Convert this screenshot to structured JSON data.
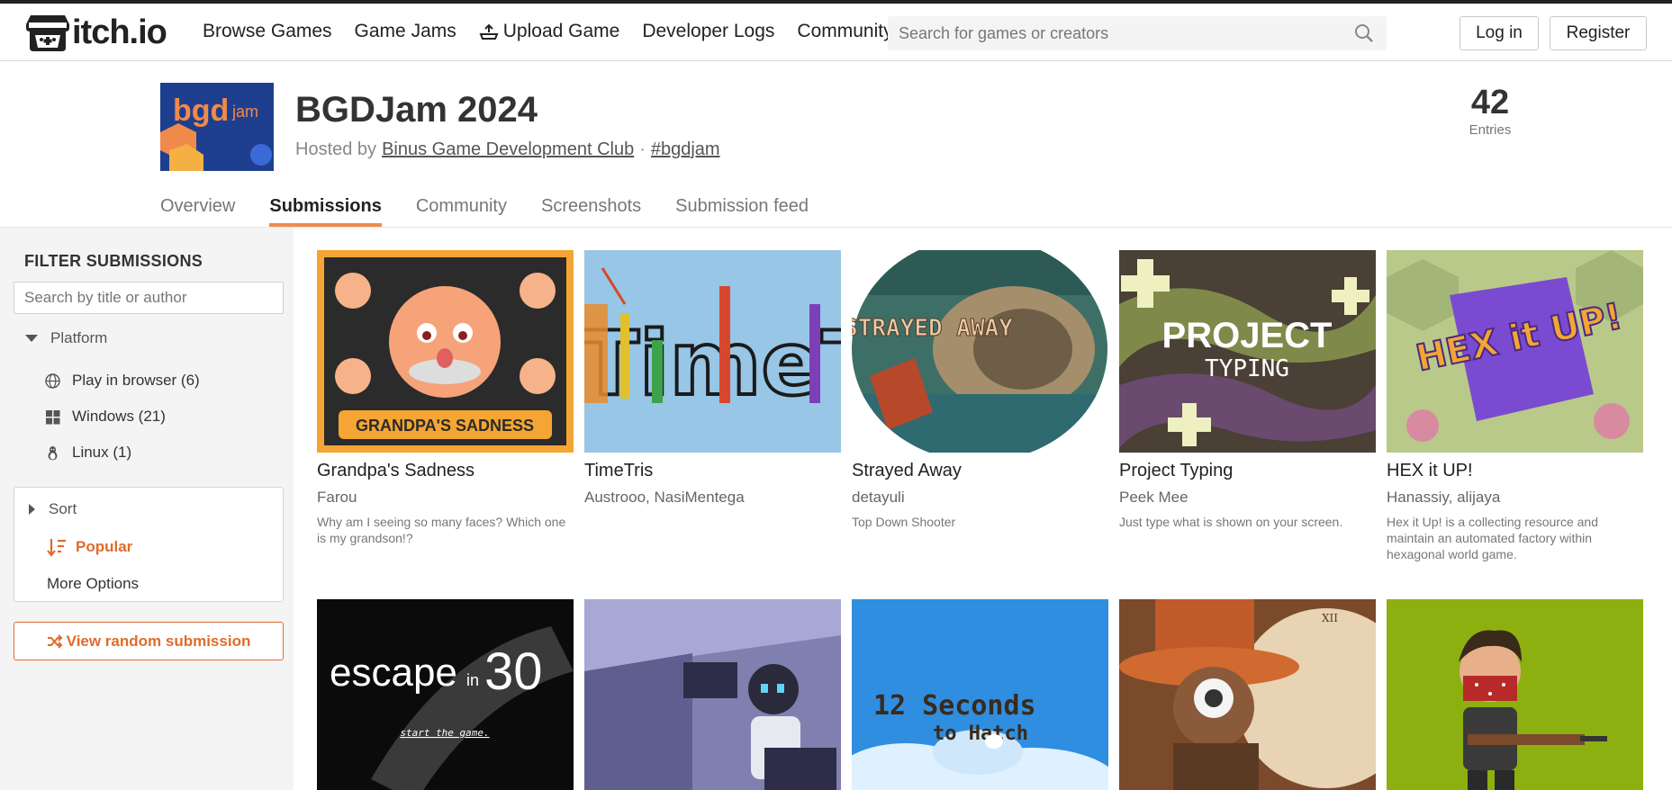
{
  "header": {
    "logo_text": "itch.io",
    "nav": [
      {
        "label": "Browse Games"
      },
      {
        "label": "Game Jams"
      },
      {
        "label": "Upload Game"
      },
      {
        "label": "Developer Logs"
      },
      {
        "label": "Community"
      }
    ],
    "search_placeholder": "Search for games or creators",
    "login_label": "Log in",
    "register_label": "Register"
  },
  "jam": {
    "title": "BGDJam 2024",
    "hosted_prefix": "Hosted by",
    "host": "Binus Game Development Club",
    "separator": "·",
    "hashtag": "#bgdjam",
    "entries_count": "42",
    "entries_label": "Entries",
    "thumb_text": "bgd",
    "thumb_jam": "jam"
  },
  "tabs": [
    {
      "label": "Overview"
    },
    {
      "label": "Submissions"
    },
    {
      "label": "Community"
    },
    {
      "label": "Screenshots"
    },
    {
      "label": "Submission feed"
    }
  ],
  "sidebar": {
    "filter_title": "FILTER SUBMISSIONS",
    "filter_placeholder": "Search by title or author",
    "platform_label": "Platform",
    "platforms": [
      {
        "label": "Play in browser (6)",
        "icon": "globe-icon"
      },
      {
        "label": "Windows (21)",
        "icon": "windows-icon"
      },
      {
        "label": "Linux (1)",
        "icon": "linux-icon"
      }
    ],
    "sort_label": "Sort",
    "sort_selected": "Popular",
    "more_options": "More Options",
    "random_label": "View random submission"
  },
  "games": [
    {
      "title": "Grandpa's Sadness",
      "author": "Farou",
      "desc": "Why am I seeing so many faces? Which one is my grandson!?",
      "thumb_text": "GRANDPA'S SADNESS"
    },
    {
      "title": "TimeTris",
      "author": "Austrooo, NasiMentega",
      "desc": "",
      "thumb_text": "TimeTris"
    },
    {
      "title": "Strayed Away",
      "author": "detayuli",
      "desc": "Top Down Shooter",
      "thumb_text": "STRAYED AWAY"
    },
    {
      "title": "Project Typing",
      "author": "Peek Mee",
      "desc": "Just type what is shown on your screen.",
      "thumb_text": "PROJECT",
      "thumb_text2": "TYPING"
    },
    {
      "title": "HEX it UP!",
      "author": "Hanassiy, alijaya",
      "desc": "Hex it Up! is a collecting resource and maintain an automated factory within hexagonal world game.",
      "thumb_text": "HEX it UP!"
    },
    {
      "title": "",
      "author": "",
      "desc": "",
      "thumb_text": "escape",
      "thumb_text2": "30",
      "thumb_text3": "in",
      "thumb_text4": "start the game."
    },
    {
      "title": "",
      "author": "",
      "desc": "",
      "thumb_text": ""
    },
    {
      "title": "",
      "author": "",
      "desc": "",
      "thumb_text": "12 Seconds",
      "thumb_text2": "to Hatch"
    },
    {
      "title": "",
      "author": "",
      "desc": "",
      "thumb_text": "XII"
    },
    {
      "title": "",
      "author": "",
      "desc": "",
      "thumb_text": ""
    }
  ]
}
